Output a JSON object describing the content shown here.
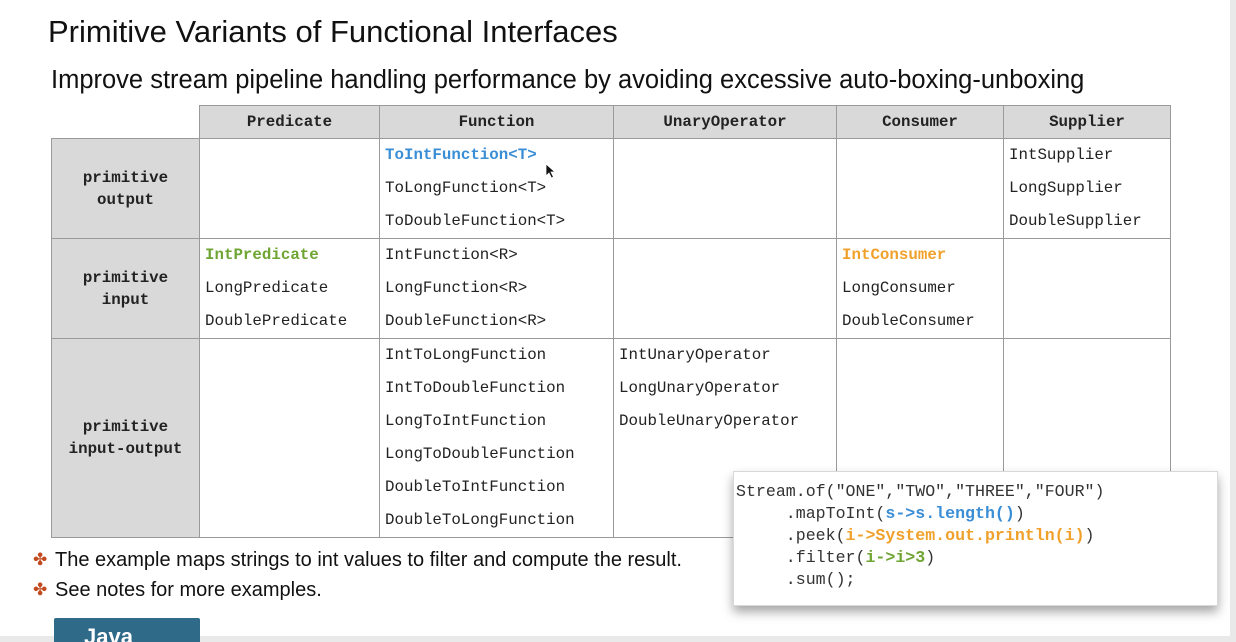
{
  "slide": {
    "title": "Primitive Variants of Functional Interfaces",
    "subtitle": "Improve stream pipeline handling performance by avoiding excessive auto-boxing-unboxing"
  },
  "table": {
    "columns": [
      "Predicate",
      "Function",
      "UnaryOperator",
      "Consumer",
      "Supplier"
    ],
    "rows": [
      {
        "header": [
          "primitive",
          "output"
        ],
        "cells": [
          [],
          [
            "ToIntFunction<T>",
            "ToLongFunction<T>",
            "ToDoubleFunction<T>"
          ],
          [],
          [],
          [
            "IntSupplier",
            "LongSupplier",
            "DoubleSupplier"
          ]
        ]
      },
      {
        "header": [
          "primitive",
          "input"
        ],
        "cells": [
          [
            "IntPredicate",
            "LongPredicate",
            "DoublePredicate"
          ],
          [
            "IntFunction<R>",
            "LongFunction<R>",
            "DoubleFunction<R>"
          ],
          [],
          [
            "IntConsumer",
            "LongConsumer",
            "DoubleConsumer"
          ],
          []
        ]
      },
      {
        "header": [
          "primitive",
          "input-output"
        ],
        "cells": [
          [],
          [
            "IntToLongFunction",
            "IntToDoubleFunction",
            "LongToIntFunction",
            "LongToDoubleFunction",
            "DoubleToIntFunction",
            "DoubleToLongFunction"
          ],
          [
            "IntUnaryOperator",
            "LongUnaryOperator",
            "DoubleUnaryOperator"
          ],
          [],
          []
        ]
      }
    ]
  },
  "bullets": [
    "The example maps strings to int values to filter and compute the result.",
    "See notes for more examples."
  ],
  "code": {
    "line1": "Stream.of(\"ONE\",\"TWO\",\"THREE\",\"FOUR\")",
    "line2_pre": "     .mapToInt(",
    "line2_hl": "s->s.length()",
    "line2_post": ")",
    "line3_pre": "     .peek(",
    "line3_hl": "i->System.out.println(i)",
    "line3_post": ")",
    "line4_pre": "     .filter(",
    "line4_hl": "i->i>3",
    "line4_post": ")",
    "line5": "     .sum();"
  },
  "colors": {
    "highlight_blue": "#3a8ed6",
    "highlight_green": "#6fa532",
    "highlight_orange": "#f0a12c",
    "header_gray": "#d9d9d9",
    "logo_blue": "#2f6a88"
  },
  "icons": {
    "bullet": "cross-bullet-icon",
    "cursor": "mouse-pointer-icon",
    "logo": "java-logo-icon"
  },
  "logo": {
    "text": "Java"
  }
}
